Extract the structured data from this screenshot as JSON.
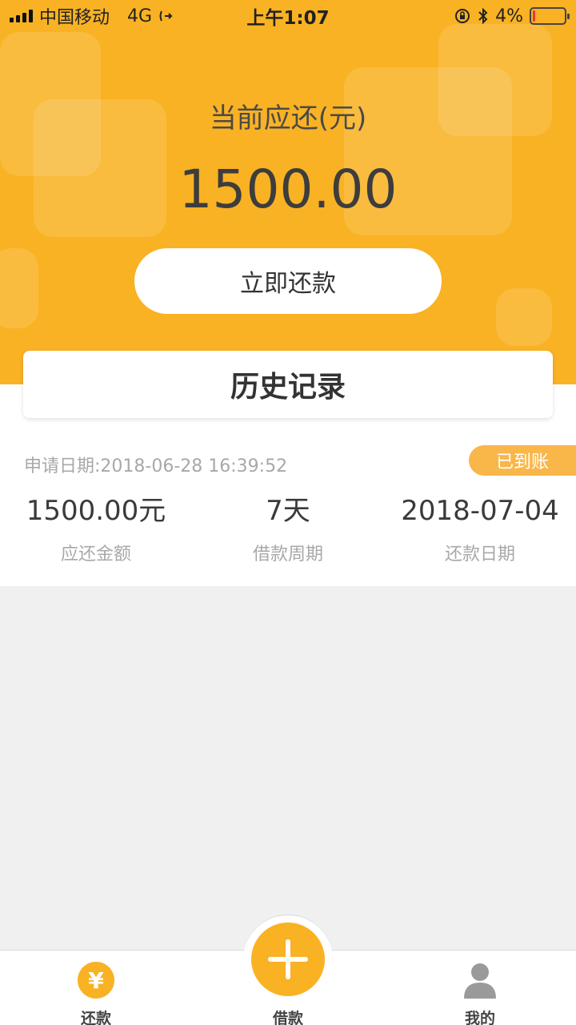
{
  "status_bar": {
    "carrier": "中国移动",
    "network": "4G",
    "time": "上午1:07",
    "battery_percent": "4%"
  },
  "hero": {
    "label": "当前应还(元)",
    "amount": "1500.00",
    "repay_button": "立即还款"
  },
  "history": {
    "title": "历史记录"
  },
  "record": {
    "date": "申请日期:2018-06-28 16:39:52",
    "status_badge": "已到账",
    "amount_value": "1500.00元",
    "amount_label": "应还金额",
    "period_value": "7天",
    "period_label": "借款周期",
    "due_value": "2018-07-04",
    "due_label": "还款日期"
  },
  "tabs": {
    "repay": "还款",
    "borrow": "借款",
    "mine": "我的"
  },
  "icons": {
    "yen": "¥"
  },
  "colors": {
    "accent": "#f9b223",
    "badge": "#f9b74a",
    "battery_low": "#e53935"
  }
}
